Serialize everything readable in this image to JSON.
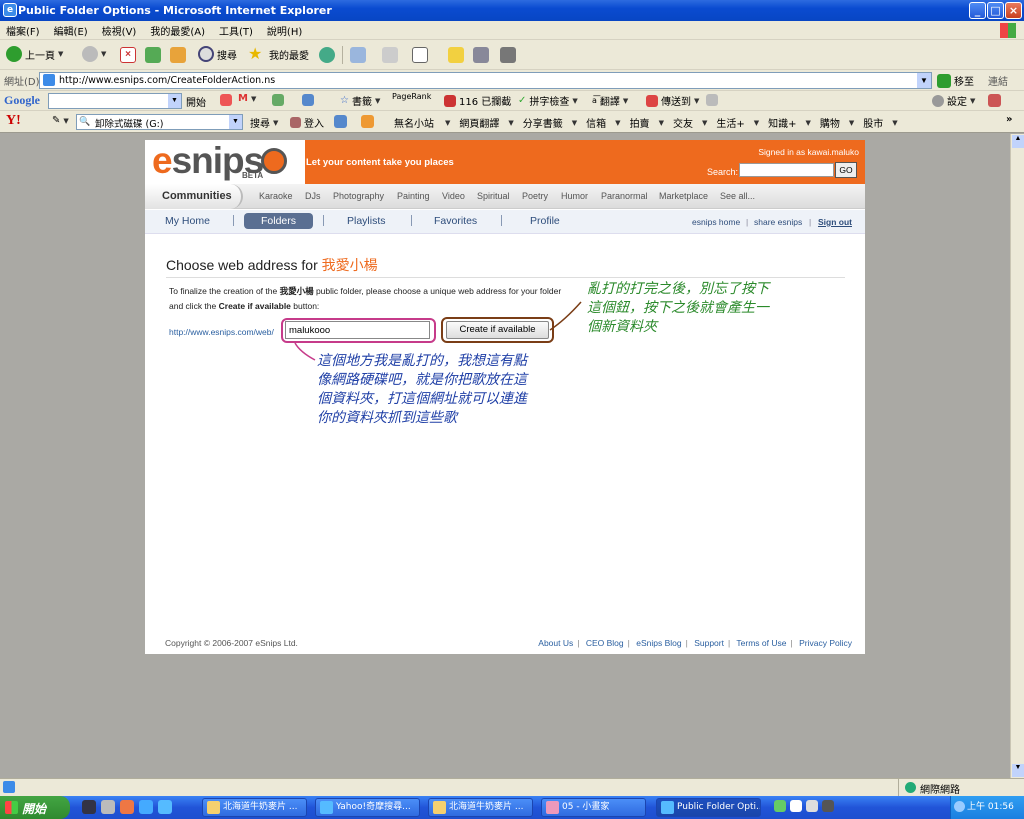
{
  "window": {
    "title": "Public Folder Options - Microsoft Internet Explorer"
  },
  "menu": [
    "檔案(F)",
    "編輯(E)",
    "檢視(V)",
    "我的最愛(A)",
    "工具(T)",
    "說明(H)"
  ],
  "toolbar": {
    "back": "上一頁",
    "search": "搜尋",
    "favorites": "我的最愛"
  },
  "address": {
    "label": "網址(D)",
    "url": "http://www.esnips.com/CreateFolderAction.ns",
    "go": "移至",
    "links": "連結"
  },
  "googlebar": {
    "logo": "Google",
    "search_btn": "開始",
    "pagerank": "PageRank",
    "blocked": "116 已攔截",
    "spell": "拼字檢查",
    "translate": "翻譯",
    "send": "傳送到",
    "settings": "設定"
  },
  "yahoobar": {
    "logo": "Y!",
    "field": "卸除式磁碟 (G:)",
    "search": "搜尋",
    "login": "登入",
    "items": [
      "無名小站",
      "網頁翻譯",
      "分享書籤",
      "信箱",
      "拍賣",
      "交友",
      "生活+",
      "知識+",
      "購物",
      "股市"
    ]
  },
  "site": {
    "logo_e": "e",
    "logo_rest": "snips",
    "beta": "BETA",
    "tagline": "Let your content take you places",
    "signed_in": "Signed in as kawai.maluko",
    "search_label": "Search:",
    "go": "GO",
    "communities": "Communities",
    "categories": [
      "Karaoke",
      "DJs",
      "Photography",
      "Painting",
      "Video",
      "Spiritual",
      "Poetry",
      "Humor",
      "Paranormal",
      "Marketplace",
      "See all..."
    ],
    "nav": {
      "my_home": "My Home",
      "folders": "Folders",
      "playlists": "Playlists",
      "favorites": "Favorites",
      "profile": "Profile",
      "esnips_home": "esnips home",
      "share": "share esnips",
      "signout": "Sign out"
    },
    "heading": "Choose web address for ",
    "heading_folder": "我愛小楊",
    "instr_1": "To finalize the creation of the ",
    "instr_folder": "我愛小楊",
    "instr_2": " public folder, please choose a unique web address for your folder and click the ",
    "instr_btn": "Create if available",
    "instr_3": " button:",
    "url_prefix": "http://www.esnips.com/web/",
    "folder_name_value": "malukooo",
    "create_button": "Create if available",
    "copyright": "Copyright © 2006-2007 eSnips Ltd.",
    "footer_links": [
      "About Us",
      "CEO Blog",
      "eSnips Blog",
      "Support",
      "Terms of Use",
      "Privacy Policy"
    ]
  },
  "annotations": {
    "note_right": [
      "亂打的打完之後，別忘了按下",
      "這個鈕，按下之後就會產生一",
      "個新資料夾"
    ],
    "note_bottom": [
      "這個地方我是亂打的，我想這有點",
      "像網路硬碟吧，就是你把歌放在這",
      "個資料夾，打這個網址就可以連進",
      "你的資料夾抓到這些歌"
    ]
  },
  "status": {
    "zone": "網際網路"
  },
  "taskbar": {
    "start": "開始",
    "tasks": [
      "北海道牛奶麥片 ...",
      "Yahoo!奇摩搜尋...",
      "北海道牛奶麥片 ...",
      "05 - 小畫家",
      "Public Folder Opti..."
    ],
    "clock": "上午 01:56"
  },
  "colors": {
    "brand_orange": "#ee6a1e",
    "nav_active": "#5a6f92",
    "annotation_blue": "#1f3fa6",
    "annotation_green": "#2b8a2b"
  }
}
